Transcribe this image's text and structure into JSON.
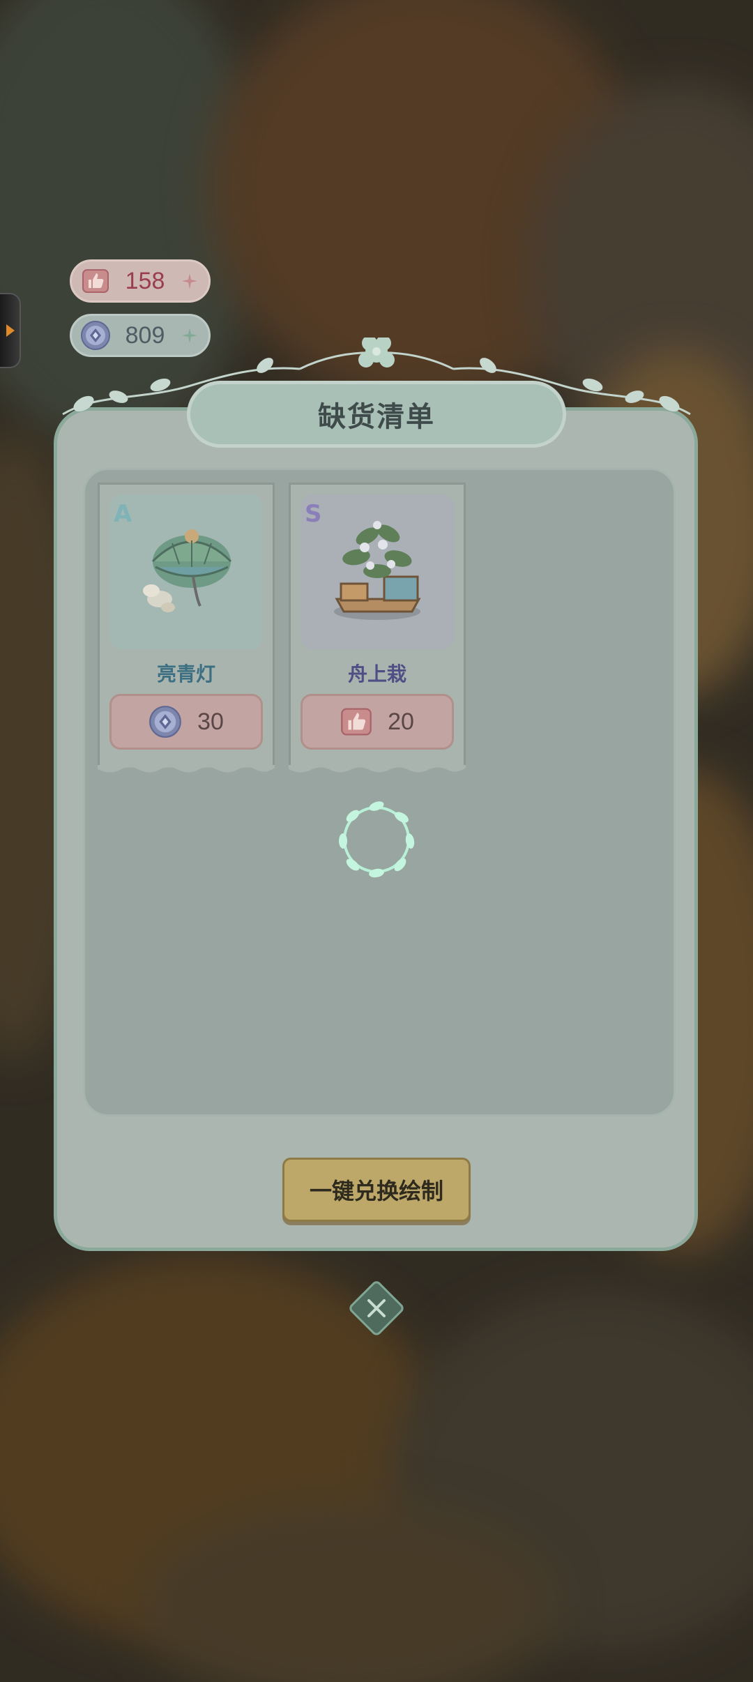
{
  "currency": {
    "likes": {
      "icon": "thumbs-up-icon",
      "value": "158"
    },
    "gems": {
      "icon": "gem-coin-icon",
      "value": "809"
    }
  },
  "dialog": {
    "title": "缺货清单",
    "items": [
      {
        "grade": "A",
        "name": "亮青灯",
        "cost_icon": "gem-coin-icon",
        "cost": "30",
        "grade_color": "#7fb3b8",
        "name_color": "#3c6f82"
      },
      {
        "grade": "S",
        "name": "舟上栽",
        "cost_icon": "thumbs-up-icon",
        "cost": "20",
        "grade_color": "#8a7fb8",
        "name_color": "#4f4f86"
      }
    ],
    "loading": true,
    "exchange_button": "一键兑换绘制",
    "close_icon": "close-icon"
  },
  "colors": {
    "panel": "#abb6b0",
    "accent_mint": "#b8f0d8",
    "button_gold": "#bda86a"
  }
}
